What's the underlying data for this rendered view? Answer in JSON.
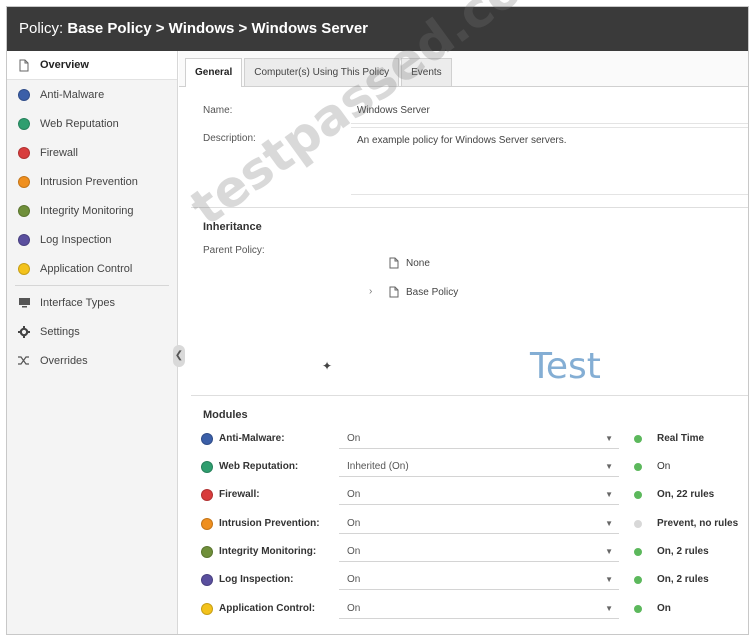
{
  "title": {
    "prefix": "Policy:",
    "path": "Base Policy > Windows > Windows Server"
  },
  "sidebar": {
    "items": [
      {
        "label": "Overview",
        "icon": "document-icon",
        "active": true
      },
      {
        "label": "Anti-Malware",
        "icon": "shield-icon",
        "color": "#3b5fa8"
      },
      {
        "label": "Web Reputation",
        "icon": "globe-icon",
        "color": "#2f9e6f"
      },
      {
        "label": "Firewall",
        "icon": "firewall-icon",
        "color": "#d83c3c"
      },
      {
        "label": "Intrusion Prevention",
        "icon": "ips-icon",
        "color": "#ef8f1e"
      },
      {
        "label": "Integrity Monitoring",
        "icon": "integrity-icon",
        "color": "#6f8f3a"
      },
      {
        "label": "Log Inspection",
        "icon": "log-icon",
        "color": "#5a4f9e"
      },
      {
        "label": "Application Control",
        "icon": "app-control-icon",
        "color": "#f3c21b"
      },
      {
        "label": "Interface Types",
        "icon": "interface-icon"
      },
      {
        "label": "Settings",
        "icon": "gear-icon"
      },
      {
        "label": "Overrides",
        "icon": "shuffle-icon"
      }
    ]
  },
  "tabs": [
    {
      "label": "General",
      "active": true
    },
    {
      "label": "Computer(s) Using This Policy"
    },
    {
      "label": "Events"
    }
  ],
  "general": {
    "name_label": "Name:",
    "name_value": "Windows Server",
    "description_label": "Description:",
    "description_value": "An example policy for Windows Server servers."
  },
  "inheritance": {
    "title": "Inheritance",
    "parent_label": "Parent Policy:",
    "options": [
      "None",
      "Base Policy"
    ]
  },
  "modules": {
    "title": "Modules",
    "rows": [
      {
        "name": "Anti-Malware:",
        "value": "On",
        "status": "Real Time",
        "dot": "#5cb85c",
        "color": "#3b5fa8"
      },
      {
        "name": "Web Reputation:",
        "value": "Inherited (On)",
        "status": "On",
        "dot": "#5cb85c",
        "color": "#2f9e6f"
      },
      {
        "name": "Firewall:",
        "value": "On",
        "status": "On, 22 rules",
        "dot": "#5cb85c",
        "color": "#d83c3c"
      },
      {
        "name": "Intrusion Prevention:",
        "value": "On",
        "status": "Prevent, no rules",
        "dot": "#d8d8d8",
        "color": "#ef8f1e"
      },
      {
        "name": "Integrity Monitoring:",
        "value": "On",
        "status": "On, 2 rules",
        "dot": "#5cb85c",
        "color": "#6f8f3a"
      },
      {
        "name": "Log Inspection:",
        "value": "On",
        "status": "On, 2 rules",
        "dot": "#5cb85c",
        "color": "#5a4f9e"
      },
      {
        "name": "Application Control:",
        "value": "On",
        "status": "On",
        "dot": "#5cb85c",
        "color": "#f3c21b"
      }
    ]
  },
  "watermark": {
    "text": "testpassed.com",
    "badge": "Test"
  }
}
